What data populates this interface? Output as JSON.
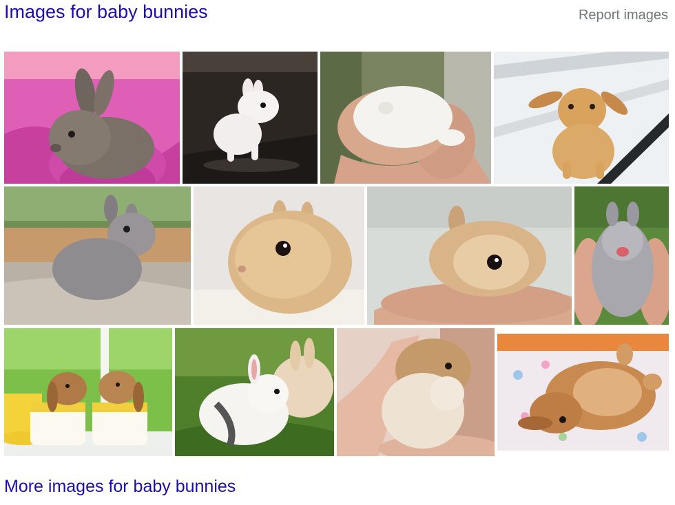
{
  "header": {
    "title": "Images for baby bunnies",
    "report_label": "Report images"
  },
  "footer": {
    "more_label": "More images for baby bunnies"
  },
  "images": [
    {
      "subject": "gray bunny on pink blanket",
      "bg": "#e05fb6",
      "fur": "#7a7068"
    },
    {
      "subject": "white bunny on dark floor",
      "bg": "#2c2622",
      "fur": "#f3eeee"
    },
    {
      "subject": "white bunny in hand",
      "bg": "#7a8461",
      "fur": "#f4f3ef"
    },
    {
      "subject": "orange lop bunny on white planks",
      "bg": "#eef1f3",
      "fur": "#d9a35d"
    },
    {
      "subject": "gray bunny on carpet",
      "bg": "#6f8f55",
      "fur": "#8f8c90"
    },
    {
      "subject": "fluffy beige bunny",
      "bg": "#e8e5e2",
      "fur": "#dcb888"
    },
    {
      "subject": "tan bunny in palm",
      "bg": "#d8dcd8",
      "fur": "#d9b489"
    },
    {
      "subject": "gray bunny on its back in hands",
      "bg": "#5b8a3c",
      "fur": "#a9a7ae"
    },
    {
      "subject": "two lop bunnies in yellow cups",
      "bg": "#7cc04a",
      "fur": "#b07a46"
    },
    {
      "subject": "white and cream bunnies in grass",
      "bg": "#4f7f2a",
      "fur": "#f5f4f1"
    },
    {
      "subject": "cream bunny in hand",
      "bg": "#e6d1c6",
      "fur": "#eee3d2"
    },
    {
      "subject": "brown bunny lying on blanket",
      "bg": "#f0eaef",
      "fur": "#c98a4f"
    }
  ]
}
